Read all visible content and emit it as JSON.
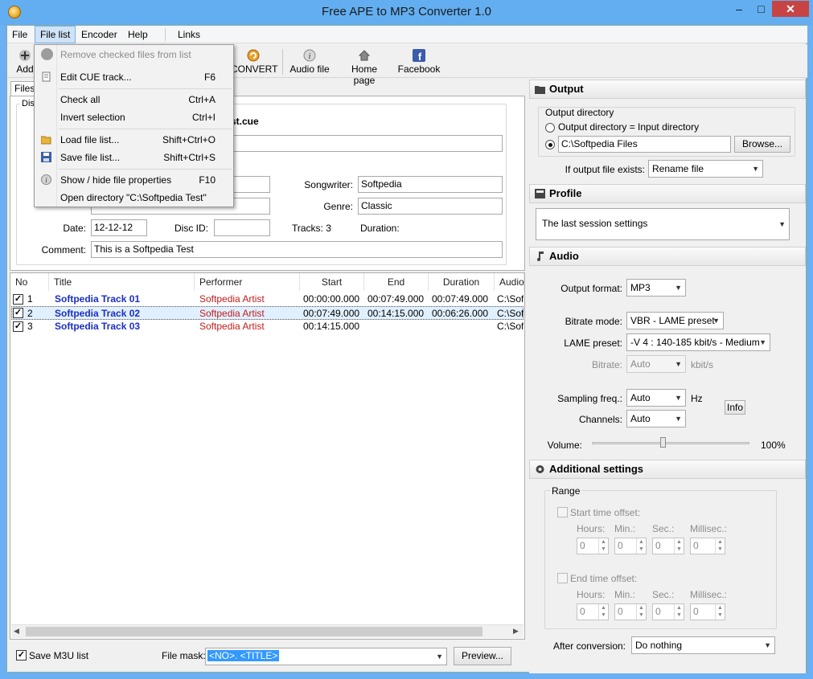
{
  "window": {
    "title": "Free APE to MP3 Converter 1.0",
    "minimize": "–",
    "maximize": "□",
    "close": "✕"
  },
  "menubar": [
    "File",
    "File list",
    "Encoder",
    "Help",
    "Links"
  ],
  "toolbar": {
    "add": "Add",
    "convert": "CONVERT",
    "audio_file": "Audio file",
    "home_page": "Home page",
    "facebook": "Facebook"
  },
  "tabs": {
    "files": "Files"
  },
  "disc": {
    "group_label": "Disc",
    "file_name_partial": "st.cue",
    "songwriter_label": "Songwriter:",
    "songwriter": "Softpedia",
    "genre_label": "Genre:",
    "genre": "Classic",
    "date_label": "Date:",
    "date": "12-12-12",
    "disc_id_label": "Disc ID:",
    "disc_id": "",
    "tracks_label": "Tracks: 3",
    "duration_label": "Duration:",
    "comment_label": "Comment:",
    "comment": "This is a Softpedia Test"
  },
  "columns": [
    "No",
    "Title",
    "Performer",
    "Start",
    "End",
    "Duration",
    "Audio"
  ],
  "tracks": [
    {
      "no": "1",
      "title": "Softpedia Track 01",
      "performer": "Softpedia Artist",
      "start": "00:00:00.000",
      "end": "00:07:49.000",
      "duration": "00:07:49.000",
      "audio": "C:\\Sof"
    },
    {
      "no": "2",
      "title": "Softpedia Track 02",
      "performer": "Softpedia Artist",
      "start": "00:07:49.000",
      "end": "00:14:15.000",
      "duration": "00:06:26.000",
      "audio": "C:\\Sof"
    },
    {
      "no": "3",
      "title": "Softpedia Track 03",
      "performer": "Softpedia Artist",
      "start": "00:14:15.000",
      "end": "",
      "duration": "",
      "audio": "C:\\Sof"
    }
  ],
  "bottom": {
    "save_m3u": "Save M3U list",
    "file_mask_label": "File mask:",
    "file_mask": "<NO>. <TITLE>",
    "preview": "Preview..."
  },
  "output": {
    "header": "Output",
    "dir_group": "Output directory",
    "radio_input_dir": "Output directory = Input directory",
    "dir_value": "C:\\Softpedia Files",
    "browse": "Browse...",
    "exists_label": "If output file exists:",
    "exists_value": "Rename file"
  },
  "profile": {
    "header": "Profile",
    "value": "The last session settings"
  },
  "audio": {
    "header": "Audio",
    "format_label": "Output format:",
    "format": "MP3",
    "bitrate_mode_label": "Bitrate mode:",
    "bitrate_mode": "VBR - LAME preset",
    "lame_preset_label": "LAME preset:",
    "lame_preset": "-V 4 : 140-185 kbit/s - Medium",
    "bitrate_label": "Bitrate:",
    "bitrate": "Auto",
    "bitrate_unit": "kbit/s",
    "sampling_label": "Sampling freq.:",
    "sampling": "Auto",
    "sampling_unit": "Hz",
    "info": "Info",
    "channels_label": "Channels:",
    "channels": "Auto",
    "volume_label": "Volume:",
    "volume_value": "100%",
    "volume_fraction": 0.45
  },
  "additional": {
    "header": "Additional settings",
    "range_label": "Range",
    "start_offset": "Start time offset:",
    "end_offset": "End time offset:",
    "hours": "Hours:",
    "min": "Min.:",
    "sec": "Sec.:",
    "millisec": "Millisec.:",
    "zero": "0",
    "after_label": "After conversion:",
    "after_value": "Do nothing"
  },
  "filelist_menu": [
    {
      "label": "Remove checked files from list",
      "shortcut": "",
      "disabled": true,
      "icon": "remove-icon"
    },
    {
      "label": "Edit CUE track...",
      "shortcut": "F6",
      "icon": "document-icon"
    },
    {
      "label": "Check all",
      "shortcut": "Ctrl+A"
    },
    {
      "label": "Invert selection",
      "shortcut": "Ctrl+I"
    },
    {
      "label": "Load file list...",
      "shortcut": "Shift+Ctrl+O",
      "icon": "folder-open-icon"
    },
    {
      "label": "Save file list...",
      "shortcut": "Shift+Ctrl+S",
      "icon": "save-icon"
    },
    {
      "label": "Show / hide file properties",
      "shortcut": "F10",
      "icon": "info-icon"
    },
    {
      "label": "Open directory \"C:\\Softpedia Test\"",
      "shortcut": ""
    }
  ],
  "colors": {
    "titlebar": "#63aef0",
    "track_title": "#1a2fc4",
    "performer": "#c21c1c",
    "selection": "#3399ff"
  }
}
